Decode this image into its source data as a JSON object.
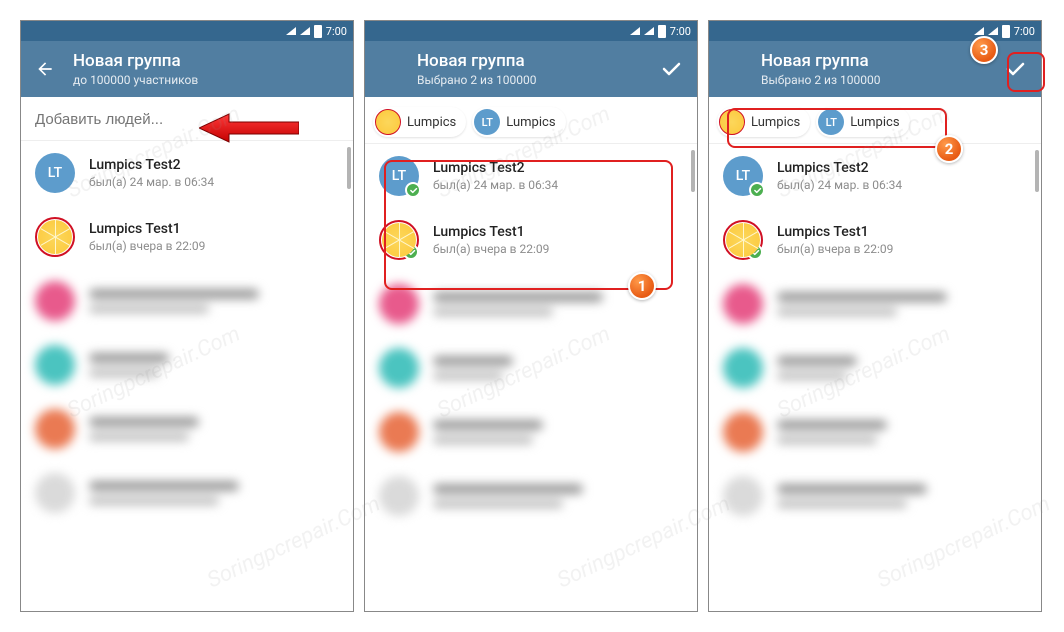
{
  "statusbar": {
    "time": "7:00"
  },
  "screens": [
    {
      "header": {
        "title": "Новая группа",
        "subtitle": "до 100000 участников"
      },
      "search": {
        "placeholder": "Добавить людей..."
      },
      "showBack": true,
      "showCheck": false,
      "showChips": false,
      "selected": false
    },
    {
      "header": {
        "title": "Новая группа",
        "subtitle": "Выбрано 2 из 100000"
      },
      "showBack": false,
      "showCheck": true,
      "showChips": true,
      "selected": true
    },
    {
      "header": {
        "title": "Новая группа",
        "subtitle": "Выбрано 2 из 100000"
      },
      "showBack": false,
      "showCheck": true,
      "showChips": true,
      "selected": true
    }
  ],
  "chips": [
    {
      "name": "Lumpics",
      "avatar": "citrus"
    },
    {
      "name": "Lumpics",
      "avatar": "lt",
      "initials": "LT"
    }
  ],
  "contacts": [
    {
      "name": "Lumpics Test2",
      "status": "был(а) 24 мар. в 06:34",
      "avatar": "lt",
      "initials": "LT"
    },
    {
      "name": "Lumpics Test1",
      "status": "был(а) вчера в 22:09",
      "avatar": "citrus"
    }
  ],
  "blurred": [
    {
      "c": "#e85a8c",
      "w1": 170,
      "w2": 120
    },
    {
      "c": "#4bc4c0",
      "w1": 80,
      "w2": 70
    },
    {
      "c": "#ea7a53",
      "w1": 110,
      "w2": 100
    },
    {
      "c": "#dadada",
      "w1": 150,
      "w2": 130
    }
  ],
  "annotations": {
    "steps": [
      "1",
      "2",
      "3"
    ]
  },
  "watermark": "Soringpcrepair.Com"
}
